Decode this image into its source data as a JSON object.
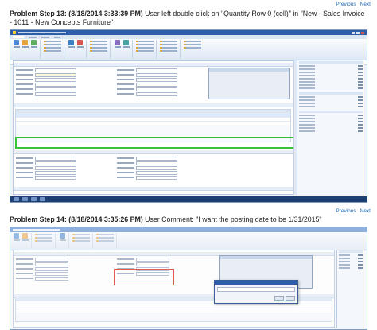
{
  "steps": [
    {
      "nav": {
        "previous": "Previous",
        "next": "Next"
      },
      "heading": "Problem Step 13: (8/18/2014 3:33:39 PM)",
      "description": " User left double click on \"Quantity Row 0 (cell)\" in \"New - Sales Invoice - 1011 - New Concepts Furniture\"",
      "highlight": "green"
    },
    {
      "nav": {
        "previous": "Previous",
        "next": "Next"
      },
      "heading": "Problem Step 14: (8/18/2014 3:35:26 PM)",
      "description": " User Comment: \"I want the posting date to be 1/31/2015\"",
      "highlight": "red"
    }
  ],
  "colors": {
    "link": "#1e6bb8",
    "green_highlight": "#35c435",
    "red_highlight": "#e0352b",
    "titlebar": "#2e5ea8"
  },
  "icons": [
    "windows-app-icon",
    "ribbon-post-icon",
    "ribbon-release-icon",
    "ribbon-navigate-icon",
    "ribbon-customer-icon",
    "ribbon-statistics-icon",
    "ribbon-dimensions-icon",
    "minimize-icon",
    "maximize-icon",
    "close-icon"
  ]
}
